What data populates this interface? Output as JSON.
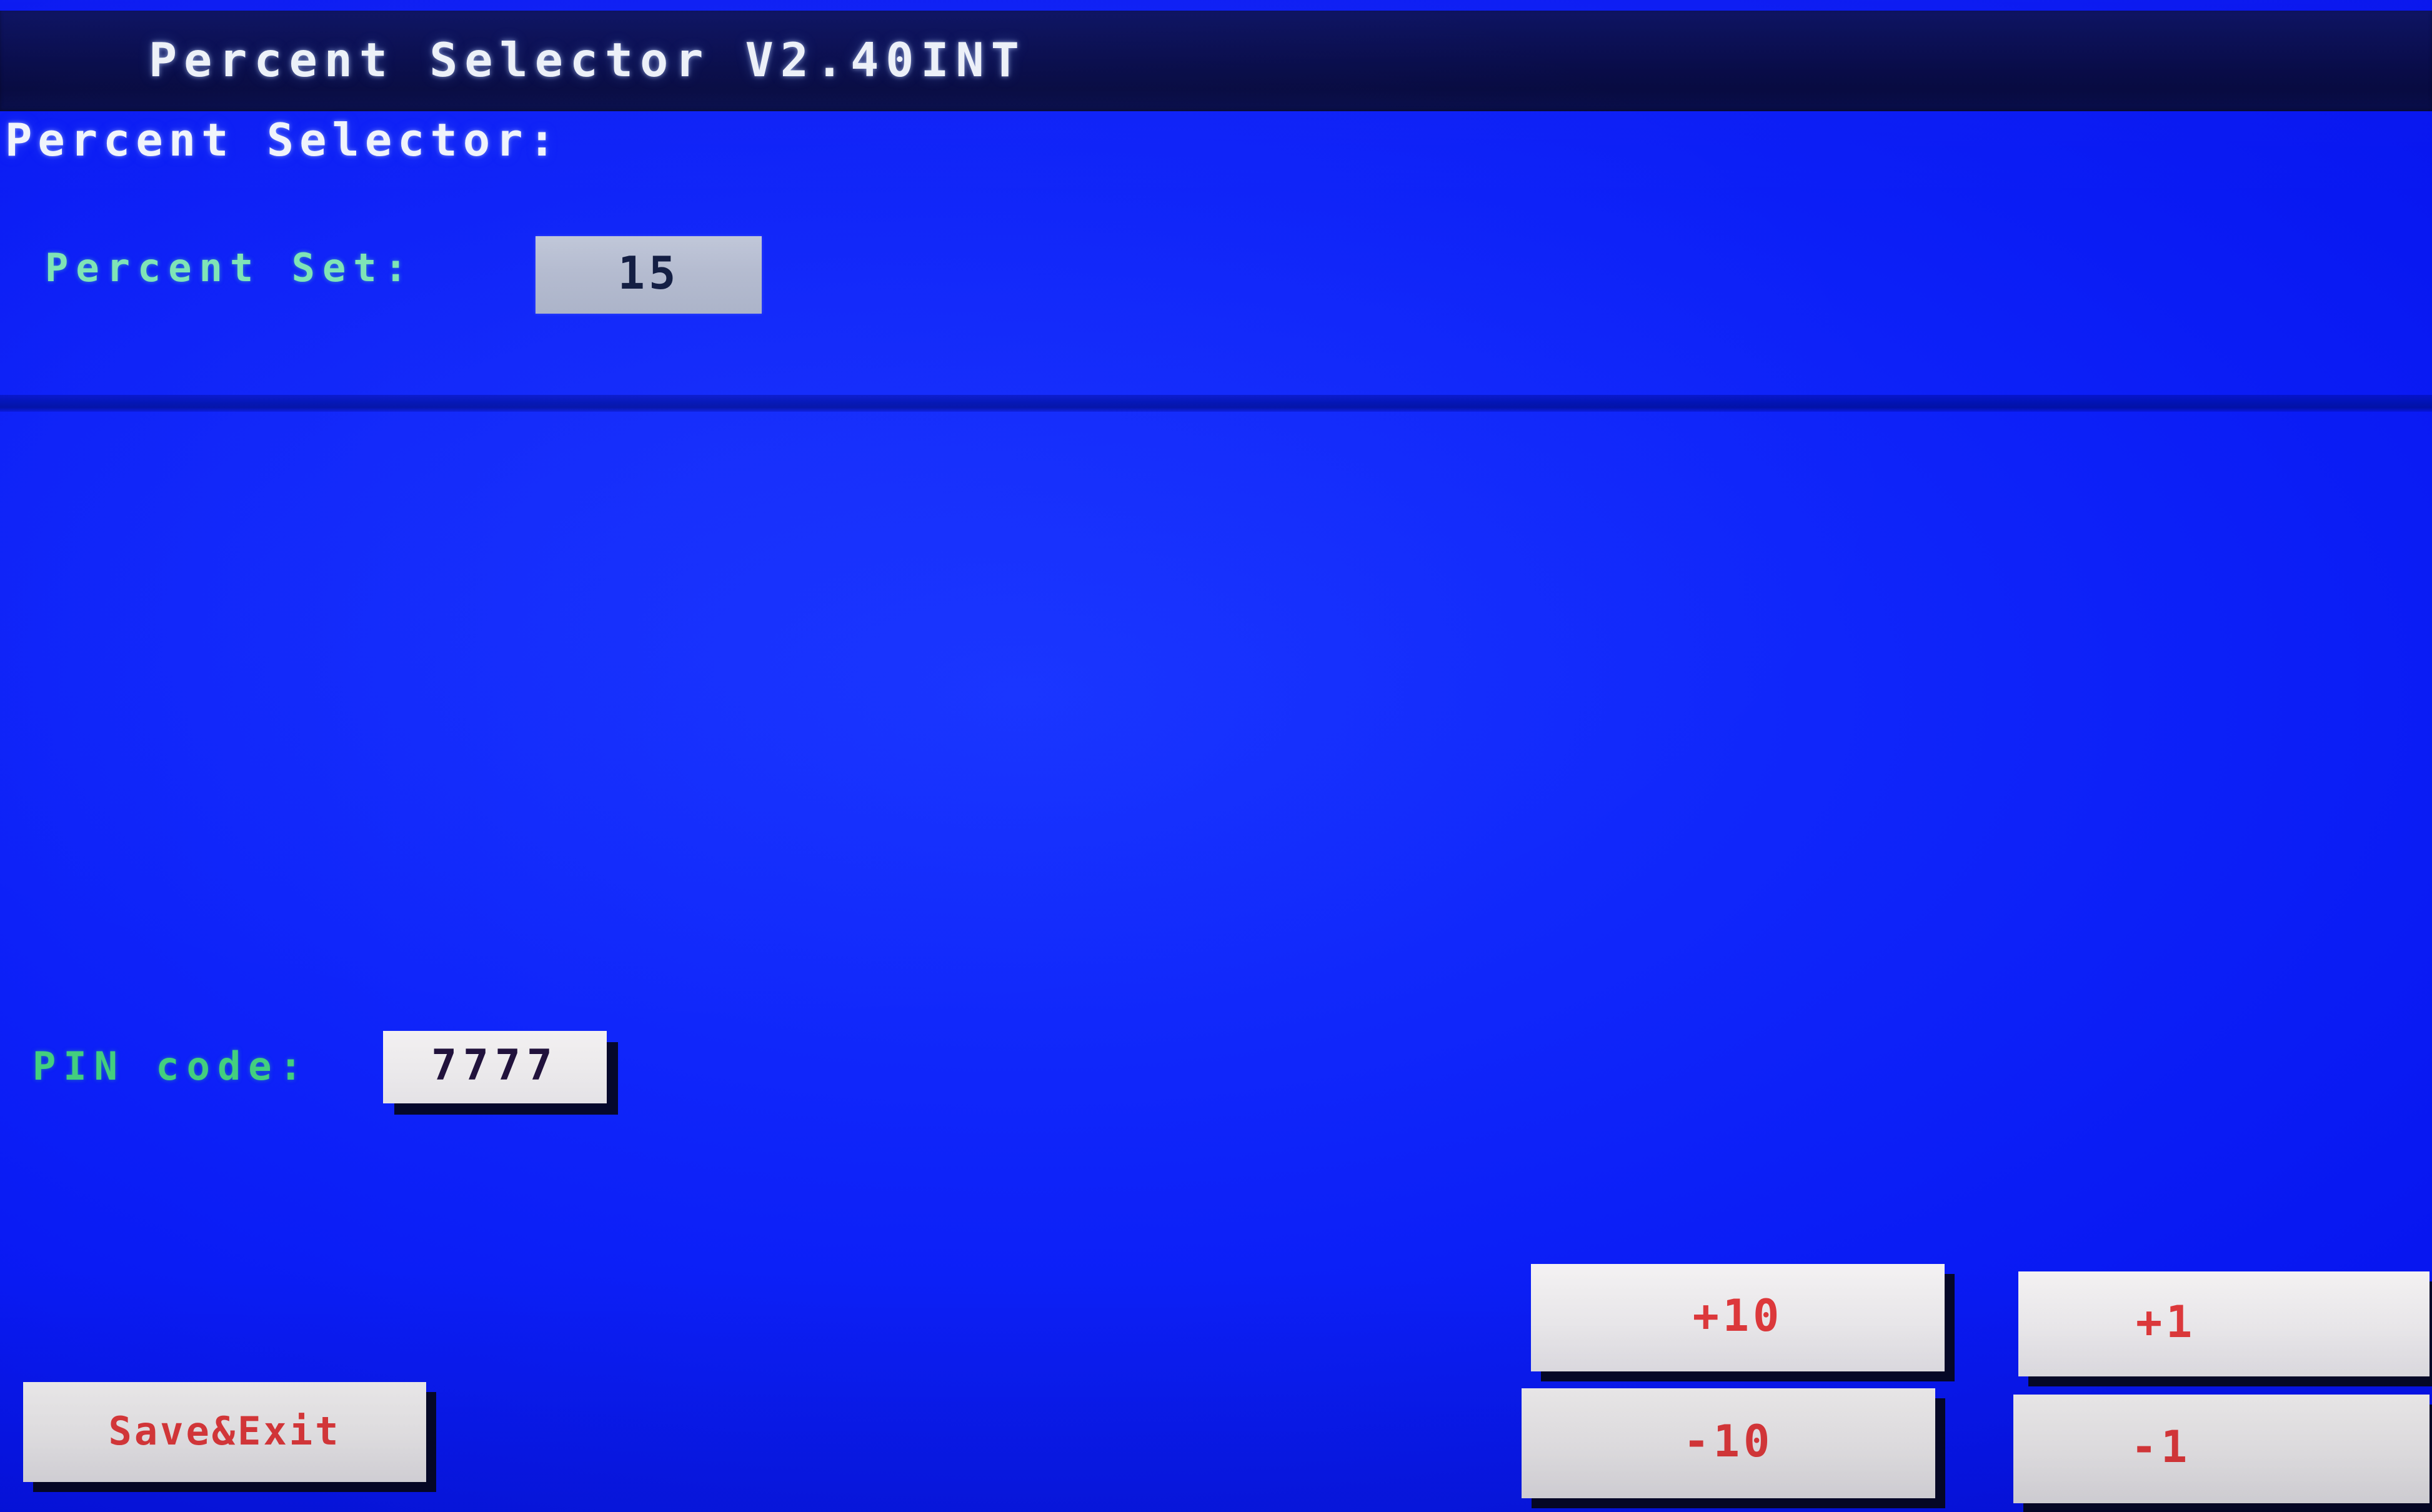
{
  "window": {
    "title": "Percent Selector V2.40INT"
  },
  "header": {
    "section_heading": "Percent Selector:"
  },
  "fields": {
    "percent_set": {
      "label": "Percent Set:",
      "value": "15"
    },
    "pin_code": {
      "label": "PIN code:",
      "value": "7777"
    }
  },
  "buttons": {
    "save_exit": "Save&Exit",
    "plus_ten": "+10",
    "minus_ten": "-10",
    "plus_one": "+1",
    "minus_one": "-1"
  },
  "colors": {
    "background_blue": "#0d21f8",
    "titlebar_navy": "#070b4e",
    "divider_blue": "#0113b4",
    "label_green": "#43cf7e",
    "button_face": "#edebee",
    "button_text_red": "#e0393c",
    "value_box_gray": "#b7bdce",
    "value_text_navy": "#101a3c",
    "title_text_white": "#eef2f8"
  }
}
